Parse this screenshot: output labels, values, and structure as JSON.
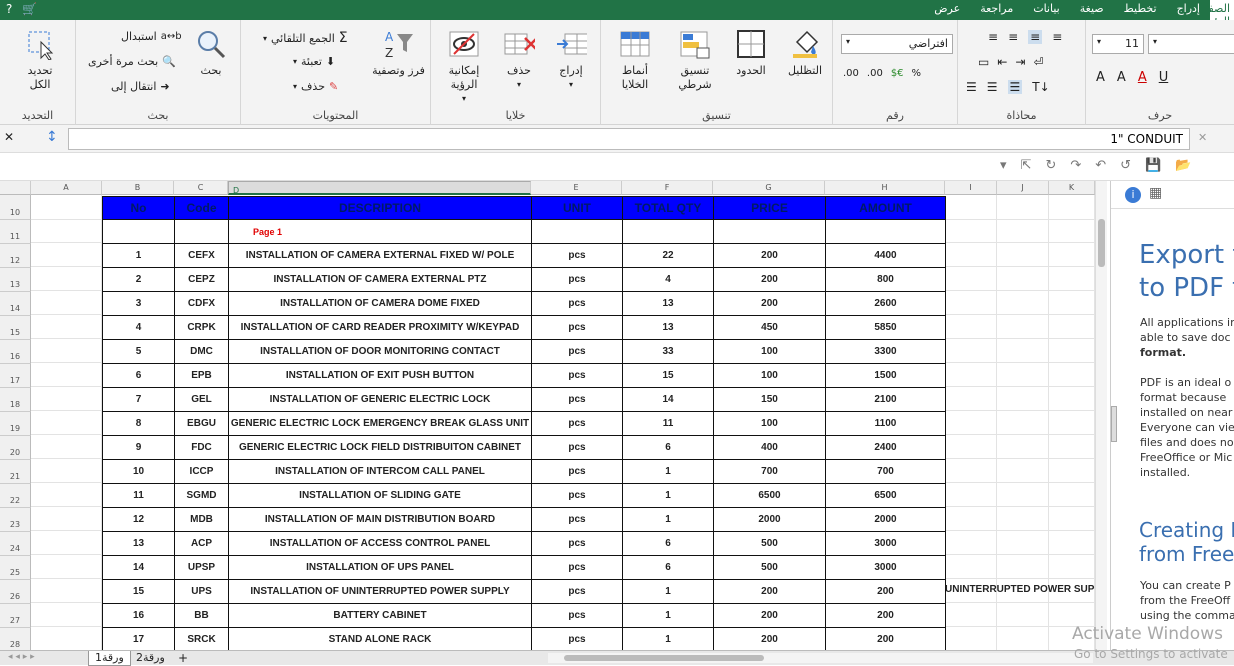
{
  "quick_access": [
    "?",
    "cart-icon"
  ],
  "ribbon_tabs": [
    "الصفحة الرئيسية",
    "إدراج",
    "تخطيط",
    "صيغة",
    "بيانات",
    "مراجعة",
    "عرض"
  ],
  "groups": {
    "font": {
      "label": "حرف",
      "size": "11",
      "font_name": ""
    },
    "alignment": {
      "label": "محاذاة"
    },
    "number": {
      "label": "رقم",
      "format": "افتراضي",
      "percent": "%"
    },
    "styles": {
      "label": "تنسيق",
      "shading": "التظليل",
      "borders": "الحدود",
      "conditional": "تنسيق شرطي",
      "cell_styles": "أنماط الخلايا"
    },
    "cells": {
      "label": "خلايا",
      "insert": "إدراج",
      "delete": "حذف",
      "visibility": "إمكانية الرؤية"
    },
    "contents": {
      "label": "المحتويات",
      "sort": "فرز وتصفية",
      "autosum": "الجمع التلقائي",
      "fill": "تعبئة",
      "delete": "حذف"
    },
    "search": {
      "label": "بحث",
      "search": "بحث",
      "replace": "استبدال",
      "search_again": "بحث مرة أخرى",
      "goto": "انتقال إلى"
    },
    "selection": {
      "label": "التحديد",
      "select_all": "تحديد الكل"
    }
  },
  "formula_bar": {
    "value": "1\" CONDUIT"
  },
  "columns": [
    "A",
    "B",
    "C",
    "D",
    "E",
    "F",
    "G",
    "H",
    "I",
    "J",
    "K"
  ],
  "rows": [
    "10",
    "11",
    "12",
    "13",
    "14",
    "15",
    "16",
    "17",
    "18",
    "19",
    "20",
    "21",
    "22",
    "23",
    "24",
    "25",
    "26",
    "27",
    "28"
  ],
  "table": {
    "headers": [
      "No",
      "Code",
      "DESCRIPTION",
      "UNIT",
      "TOTAL QTY",
      "PRICE",
      "AMOUNT"
    ],
    "page_label": "Page 1",
    "rows": [
      [
        "1",
        "CEFX",
        "INSTALLATION OF CAMERA EXTERNAL FIXED W/ POLE",
        "pcs",
        "22",
        "200",
        "4400"
      ],
      [
        "2",
        "CEPZ",
        "INSTALLATION OF CAMERA EXTERNAL PTZ",
        "pcs",
        "4",
        "200",
        "800"
      ],
      [
        "3",
        "CDFX",
        "INSTALLATION OF CAMERA DOME FIXED",
        "pcs",
        "13",
        "200",
        "2600"
      ],
      [
        "4",
        "CRPK",
        "INSTALLATION OF CARD READER PROXIMITY W/KEYPAD",
        "pcs",
        "13",
        "450",
        "5850"
      ],
      [
        "5",
        "DMC",
        "INSTALLATION OF DOOR MONITORING CONTACT",
        "pcs",
        "33",
        "100",
        "3300"
      ],
      [
        "6",
        "EPB",
        "INSTALLATION OF EXIT PUSH BUTTON",
        "pcs",
        "15",
        "100",
        "1500"
      ],
      [
        "7",
        "GEL",
        "INSTALLATION OF GENERIC ELECTRIC LOCK",
        "pcs",
        "14",
        "150",
        "2100"
      ],
      [
        "8",
        "EBGU",
        "GENERIC ELECTRIC LOCK EMERGENCY BREAK GLASS UNIT",
        "pcs",
        "11",
        "100",
        "1100"
      ],
      [
        "9",
        "FDC",
        "GENERIC ELECTRIC LOCK FIELD DISTRIBUITON CABINET",
        "pcs",
        "6",
        "400",
        "2400"
      ],
      [
        "10",
        "ICCP",
        "INSTALLATION OF INTERCOM CALL PANEL",
        "pcs",
        "1",
        "700",
        "700"
      ],
      [
        "11",
        "SGMD",
        "INSTALLATION OF SLIDING GATE",
        "pcs",
        "1",
        "6500",
        "6500"
      ],
      [
        "12",
        "MDB",
        "INSTALLATION OF MAIN DISTRIBUTION BOARD",
        "pcs",
        "1",
        "2000",
        "2000"
      ],
      [
        "13",
        "ACP",
        "INSTALLATION OF ACCESS CONTROL PANEL",
        "pcs",
        "6",
        "500",
        "3000"
      ],
      [
        "14",
        "UPSP",
        "INSTALLATION OF UPS PANEL",
        "pcs",
        "6",
        "500",
        "3000"
      ],
      [
        "15",
        "UPS",
        "INSTALLATION OF UNINTERRUPTED POWER SUPPLY",
        "pcs",
        "1",
        "200",
        "200"
      ],
      [
        "16",
        "BB",
        "BATTERY CABINET",
        "pcs",
        "1",
        "200",
        "200"
      ],
      [
        "17",
        "SRCK",
        "STAND ALONE RACK",
        "pcs",
        "1",
        "200",
        "200"
      ]
    ],
    "spill_text": "UNINTERRUPTED POWER SUPPLY"
  },
  "side_panel": {
    "h1_line1": "Export t",
    "h1_line2": "to PDF f",
    "p1": [
      "All applications in",
      "able to save doc",
      "format."
    ],
    "p2": [
      "PDF is an ideal o",
      "format because",
      "installed on near",
      "Everyone can vie",
      "files and does no",
      "FreeOffice or Mic",
      "installed."
    ],
    "h2_line1": "Creating P",
    "h2_line2": "from FreeO",
    "p3": [
      "You can create P",
      "from the FreeOff",
      "using the comma"
    ]
  },
  "sheet_tabs": [
    "ورقة1",
    "ورقة2"
  ],
  "watermark": {
    "line1": "Activate Windows",
    "line2": "Go to Settings to activate"
  }
}
